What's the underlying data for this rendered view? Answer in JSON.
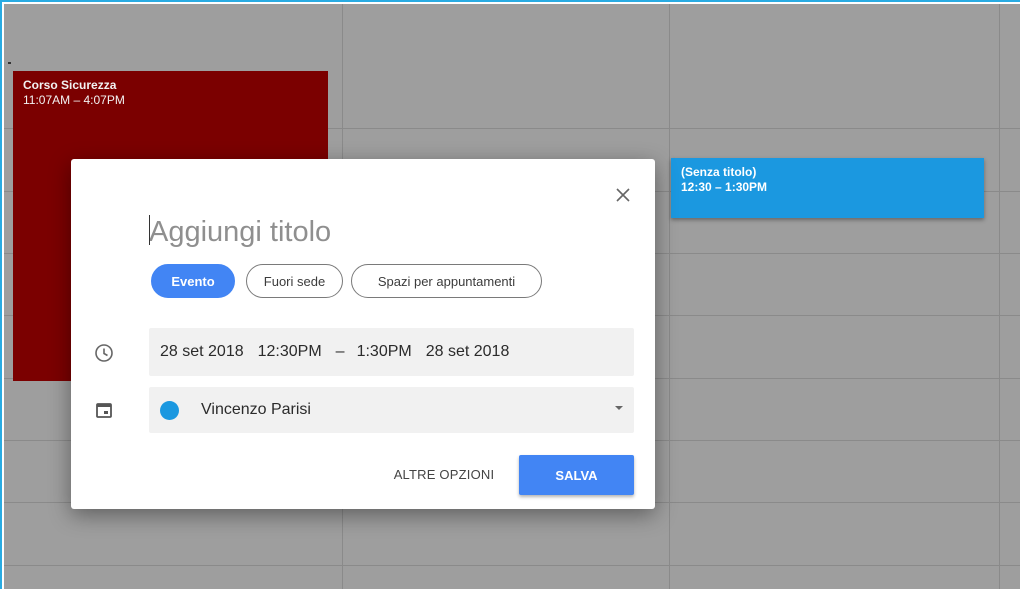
{
  "calendar": {
    "events": [
      {
        "title": "Corso Sicurezza",
        "time": "11:07AM – 4:07PM",
        "color": "#7b0000"
      },
      {
        "title": "(Senza titolo)",
        "time": "12:30 – 1:30PM",
        "color": "#1b98e0"
      }
    ]
  },
  "dialog": {
    "title_placeholder": "Aggiungi titolo",
    "chips": [
      {
        "label": "Evento",
        "selected": true
      },
      {
        "label": "Fuori sede",
        "selected": false
      },
      {
        "label": "Spazi per appuntamenti",
        "selected": false
      }
    ],
    "datetime": {
      "start_date": "28 set 2018",
      "start_time": "12:30PM",
      "separator": "–",
      "end_time": "1:30PM",
      "end_date": "28 set 2018"
    },
    "calendar_owner": "Vincenzo Parisi",
    "calendar_color": "#1b98e0",
    "more_options_label": "ALTRE OPZIONI",
    "save_label": "SALVA",
    "accent_color": "#4285f4",
    "icons": {
      "close": "close-icon",
      "clock": "clock-icon",
      "calendar": "calendar-icon"
    }
  }
}
